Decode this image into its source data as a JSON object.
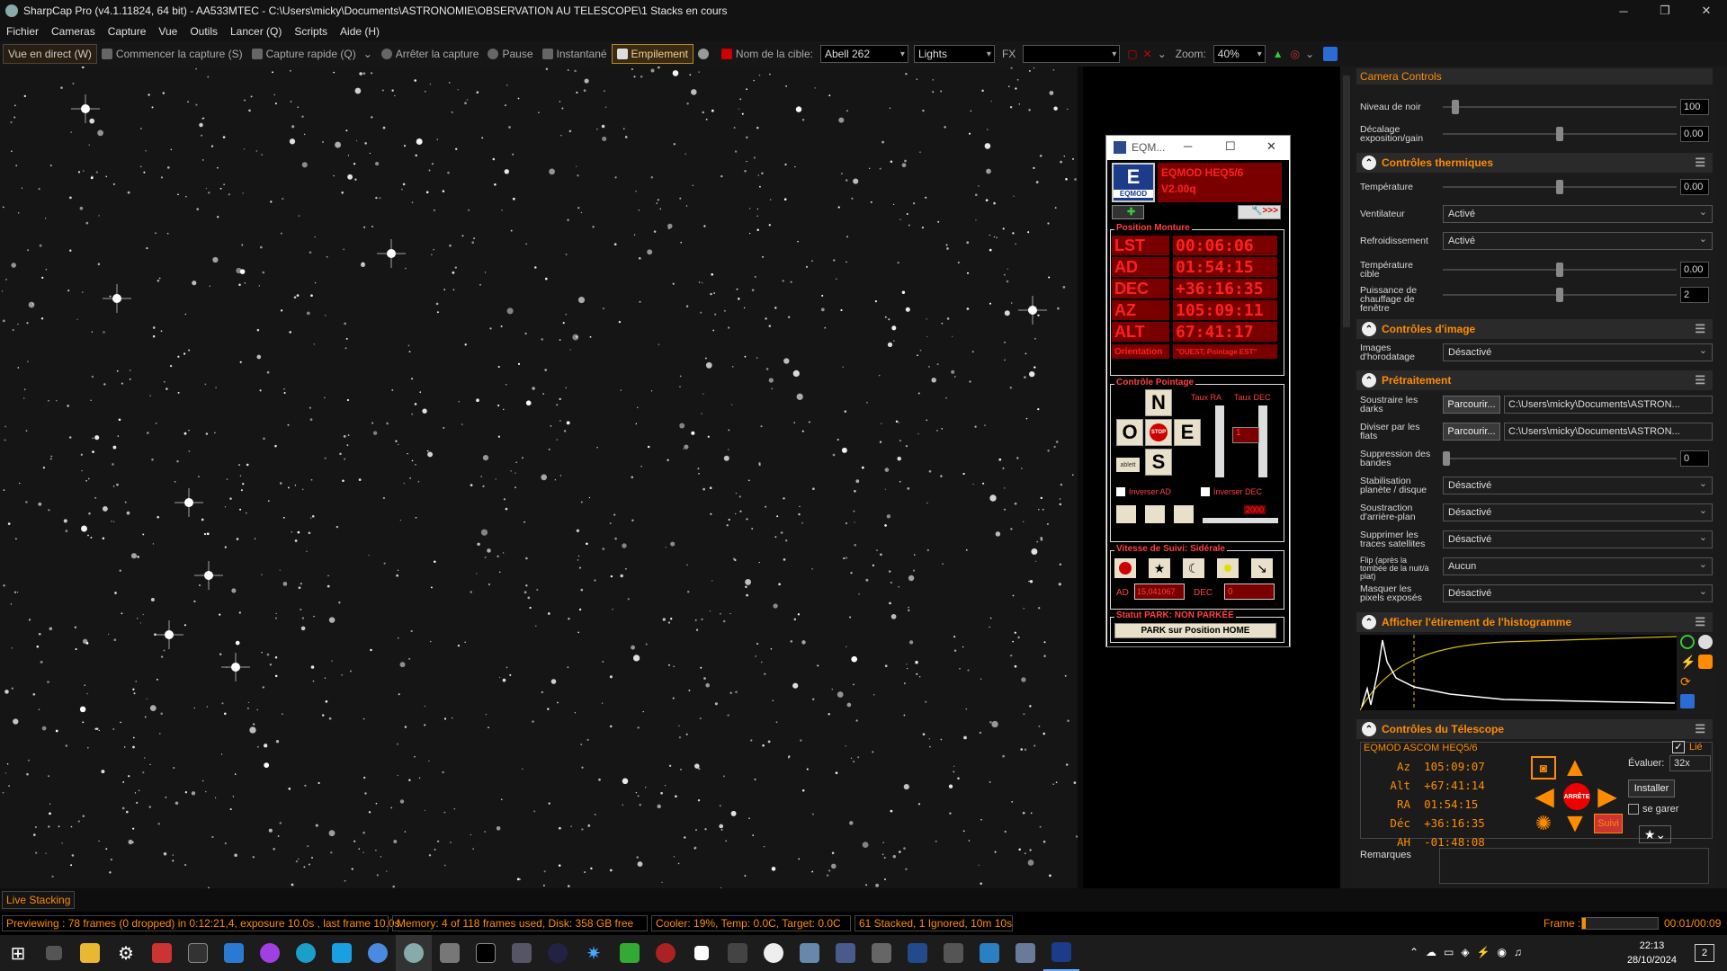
{
  "window": {
    "title": "SharpCap Pro (v4.1.11824, 64 bit) - AA533MTEC - C:\\Users\\micky\\Documents\\ASTRONOMIE\\OBSERVATION AU TELESCOPE\\1 Stacks en cours"
  },
  "menu": [
    "Fichier",
    "Cameras",
    "Capture",
    "Vue",
    "Outils",
    "Lancer (Q)",
    "Scripts",
    "Aide (H)"
  ],
  "toolbar": {
    "live_view": "Vue en direct (W)",
    "start_capture": "Commencer la capture (S)",
    "quick_capture": "Capture rapide (Q)",
    "stop_capture": "Arrêter la capture",
    "pause": "Pause",
    "snapshot": "Instantané",
    "stacking": "Empilement",
    "target_label": "Nom de la cible:",
    "target_value": "Abell 262",
    "frame_type": "Lights",
    "fx_label": "FX",
    "fx_value": "",
    "zoom_label": "Zoom:",
    "zoom_value": "40%"
  },
  "eqmod": {
    "window_title": "EQM...",
    "logo_letter": "E",
    "logo_text": "EQMOD",
    "version_line1": "EQMOD HEQ5/6",
    "version_line2": "V2.00q",
    "position_title": "Position Monture",
    "rows": [
      {
        "key": "LST",
        "value": "00:06:06"
      },
      {
        "key": "AD",
        "value": "01:54:15"
      },
      {
        "key": "DEC",
        "value": "+36:16:35"
      },
      {
        "key": "AZ",
        "value": "105:09:11"
      },
      {
        "key": "ALT",
        "value": "67:41:17"
      }
    ],
    "orientation_label": "Orientation",
    "orientation_value": "\"OUEST, Pointage EST\"",
    "pointing_title": "Contrôle Pointage",
    "rate_ra": "Taux RA",
    "rate_dec": "Taux DEC",
    "dir_n": "N",
    "dir_o": "O",
    "dir_e": "E",
    "dir_s": "S",
    "stop": "STOP",
    "pad_label": "ablett",
    "rate_value": "1",
    "invert_ad": "Inverser AD",
    "invert_dec": "Inverser DEC",
    "speed_num": "2000",
    "tracking_title": "Vitesse de Suivi: Sidérale",
    "ad_label": "AD",
    "ad_rate": "15,041067",
    "dec_label": "DEC",
    "dec_rate": "0",
    "park_status": "Statut PARK: NON PARKÉE",
    "park_button": "PARK sur Position HOME"
  },
  "panel": {
    "camera_controls": "Camera Controls",
    "black_level_label": "Niveau de noir",
    "black_level_value": "100",
    "exposure_offset_label": "Décalage exposition/gain",
    "exposure_offset_value": "0.00",
    "thermal_title": "Contrôles thermiques",
    "temp_label": "Température",
    "temp_value": "0.00",
    "fan_label": "Ventilateur",
    "fan_value": "Activé",
    "cooling_label": "Refroidissement",
    "cooling_value": "Activé",
    "target_temp_label": "Température cible",
    "target_temp_value": "0.00",
    "heater_label": "Puissance de chauffage de fenêtre",
    "heater_value": "2",
    "image_title": "Contrôles d'image",
    "timestamp_label": "Images d'horodatage",
    "timestamp_value": "Désactivé",
    "preproc_title": "Prétraitement",
    "darks_label": "Soustraire les darks",
    "flats_label": "Diviser par les flats",
    "browse": "Parcourir...",
    "darks_path": "C:\\Users\\micky\\Documents\\ASTRON...",
    "flats_path": "C:\\Users\\micky\\Documents\\ASTRON...",
    "banding_label": "Suppression des bandes",
    "banding_value": "0",
    "stabilization_label": "Stabilisation planète / disque",
    "stabilization_value": "Désactivé",
    "background_label": "Soustraction d'arrière-plan",
    "background_value": "Désactivé",
    "satellite_label": "Supprimer les traces satellites",
    "satellite_value": "Désactivé",
    "flip_label": "Flip (après la tombée de la nuit/à plat)",
    "flip_value": "Aucun",
    "mask_label": "Masquer les pixels exposés",
    "mask_value": "Désactivé",
    "histogram_title": "Afficher l'étirement de l'histogramme",
    "telescope_title": "Contrôles du Télescope",
    "telescope_name": "EQMOD ASCOM HEQ5/6",
    "linked": "Lié",
    "tel_rows": [
      {
        "k": "Az",
        "v": "105:09:07"
      },
      {
        "k": "Alt",
        "v": "+67:41:14"
      },
      {
        "k": "RA",
        "v": "01:54:15"
      },
      {
        "k": "Déc",
        "v": "+36:16:35"
      },
      {
        "k": "AH",
        "v": "-01:48:08"
      }
    ],
    "slew_label": "Évaluer:",
    "slew_value": "32x",
    "install": "Installer",
    "park": "se garer",
    "stop": "ARRÊTE",
    "track": "Suivi",
    "remarks": "Remarques"
  },
  "livebar": {
    "tab": "Live Stacking"
  },
  "status": {
    "preview": "Previewing : 78 frames (0 dropped) in 0:12:21,4, exposure 10.0s , last frame 10.0s",
    "memory": "Memory: 4 of 118 frames used, Disk: 358 GB free",
    "cooler": "Cooler: 19%, Temp: 0.0C, Target: 0.0C",
    "stacked": "61 Stacked, 1 Ignored, 10m 10s",
    "frame_label": "Frame :",
    "frame_time": "00:01/00:09"
  },
  "clock": {
    "time": "22:13",
    "date": "28/10/2024",
    "notif": "2"
  },
  "colors": {
    "accent": "#ff8c00",
    "eqmod_red": "#ff2020",
    "eqmod_bg": "#7a0000"
  }
}
